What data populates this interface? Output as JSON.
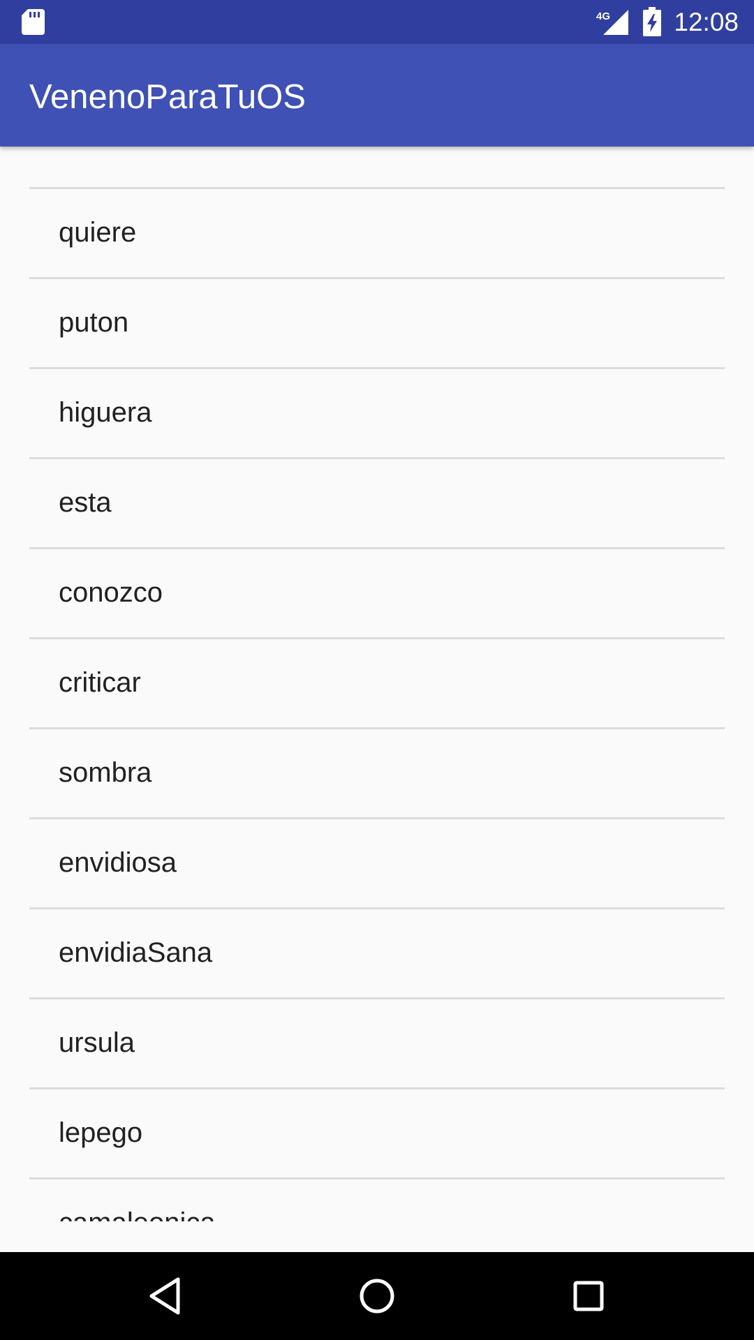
{
  "status_bar": {
    "time": "12:08",
    "network": "4G",
    "icons": [
      "sd-card-icon",
      "signal-4g-icon",
      "battery-charging-icon"
    ]
  },
  "app_bar": {
    "title": "VenenoParaTuOS"
  },
  "list": {
    "items": [
      "quiere",
      "puton",
      "higuera",
      "esta",
      "conozco",
      "criticar",
      "sombra",
      "envidiosa",
      "envidiaSana",
      "ursula",
      "lepego",
      "camaleonica"
    ]
  },
  "nav_bar": {
    "icons": [
      "back-icon",
      "home-icon",
      "recents-icon"
    ]
  },
  "colors": {
    "status_bar": "#303f9f",
    "app_bar": "#3f51b5",
    "background": "#fafafa",
    "divider": "#dcdcdc",
    "text": "#212121"
  }
}
